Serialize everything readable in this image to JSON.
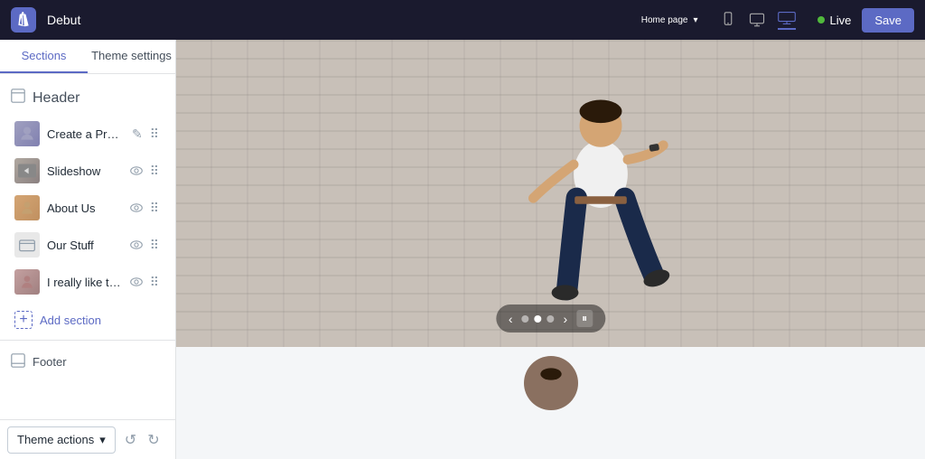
{
  "topbar": {
    "store_name": "Debut",
    "page_label": "Home page",
    "live_label": "Live",
    "save_label": "Save",
    "viewport_icons": [
      "mobile",
      "desktop",
      "widescreen"
    ]
  },
  "sidebar": {
    "tab_sections": "Sections",
    "tab_theme_settings": "Theme settings",
    "header_label": "Header",
    "footer_label": "Footer",
    "add_section_label": "Add section",
    "items": [
      {
        "label": "Create a Pro Te...",
        "id": "create-pro",
        "has_eye": false,
        "has_pencil": true
      },
      {
        "label": "Slideshow",
        "id": "slideshow",
        "has_eye": true
      },
      {
        "label": "About Us",
        "id": "about-us",
        "has_eye": true
      },
      {
        "label": "Our Stuff",
        "id": "our-stuff",
        "has_eye": true
      },
      {
        "label": "I really like thes...",
        "id": "likes",
        "has_eye": true
      }
    ]
  },
  "bottom_bar": {
    "theme_actions_label": "Theme actions"
  },
  "slider": {
    "dots": [
      false,
      true,
      false
    ]
  },
  "icons": {
    "eye": "👁",
    "drag": "⠿",
    "plus": "+",
    "pencil": "✎",
    "undo": "↺",
    "redo": "↻",
    "chevron_down": "▾",
    "chevron_left": "‹",
    "chevron_right": "›",
    "pause": "⏸",
    "mobile": "📱",
    "desktop": "🖥",
    "wide": "⬜"
  },
  "colors": {
    "accent": "#5c6ac4",
    "live": "#50b83c"
  }
}
